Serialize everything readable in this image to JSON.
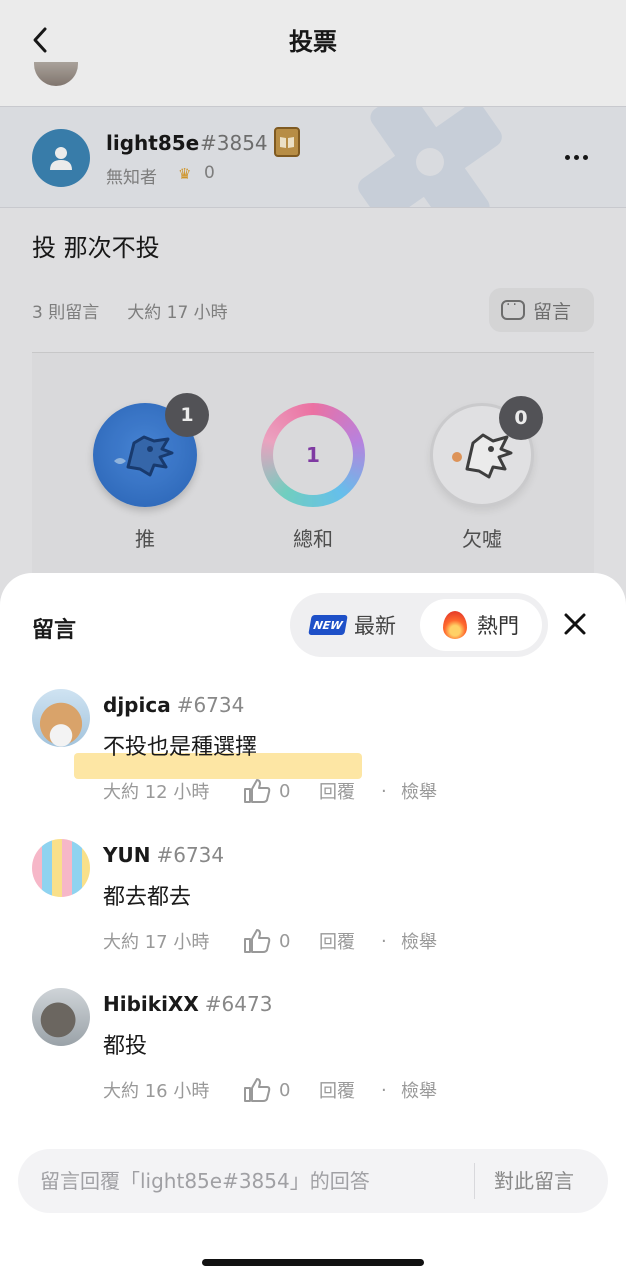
{
  "header": {
    "title": "投票"
  },
  "post": {
    "author_name": "light85e",
    "author_tag": "#3854",
    "author_rank": "無知者",
    "author_score": "0",
    "text": "投 那次不投",
    "comment_count": "3 則留言",
    "time": "大約 17 小時",
    "comment_button": "留言"
  },
  "votes": {
    "push": {
      "label": "推",
      "count": "1"
    },
    "sum": {
      "label": "總和",
      "value": "1"
    },
    "boo": {
      "label": "欠噓",
      "count": "0"
    }
  },
  "comments_sheet": {
    "title": "留言",
    "sort_newest": "最新",
    "sort_hot": "熱門",
    "new_badge": "NEW",
    "active_sort": "熱門"
  },
  "comments": [
    {
      "name": "djpica",
      "tag": "#6734",
      "text": "不投也是種選擇",
      "time": "大約 12 小時",
      "likes": "0",
      "reply": "回覆",
      "dot": "·",
      "report": "檢舉"
    },
    {
      "name": "YUN",
      "tag": "#6734",
      "text": "都去都去",
      "time": "大約 17 小時",
      "likes": "0",
      "reply": "回覆",
      "dot": "·",
      "report": "檢舉"
    },
    {
      "name": "HibikiXX",
      "tag": "#6473",
      "text": "都投",
      "time": "大約 16 小時",
      "likes": "0",
      "reply": "回覆",
      "dot": "·",
      "report": "檢舉"
    }
  ],
  "reply_bar": {
    "placeholder": "留言回覆「light85e#3854」的回答",
    "submit": "對此留言"
  },
  "colors": {
    "accent_blue": "#2d6cc4",
    "highlight": "#fde39a",
    "flame": "#ff6a2e"
  }
}
